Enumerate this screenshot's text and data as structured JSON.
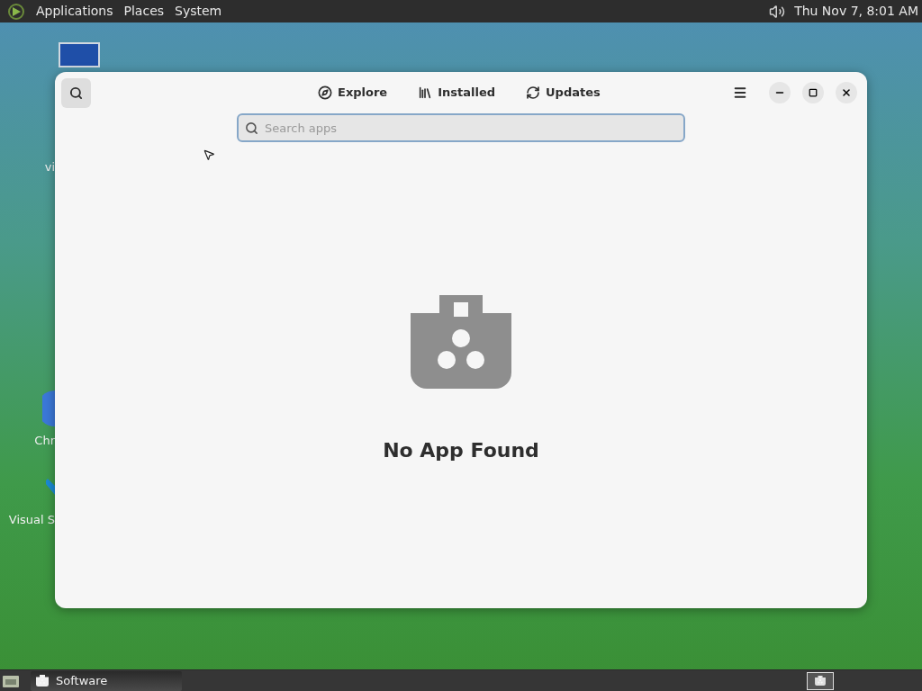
{
  "top_panel": {
    "menus": [
      "Applications",
      "Places",
      "System"
    ],
    "clock": "Thu Nov 7, 8:01 AM"
  },
  "desktop_icons": [
    {
      "kind": "monitor",
      "label": "vi"
    },
    {
      "kind": "browser",
      "label": "Chr"
    },
    {
      "kind": "editor",
      "label": "Visual S"
    }
  ],
  "window": {
    "search_toggle": {
      "active": true
    },
    "tabs": [
      {
        "kind": "explore",
        "label": "Explore",
        "selected": false
      },
      {
        "kind": "installed",
        "label": "Installed",
        "selected": false
      },
      {
        "kind": "updates",
        "label": "Updates",
        "selected": false
      }
    ],
    "search": {
      "placeholder": "Search apps",
      "focused": true
    },
    "empty_state": {
      "message": "No App Found"
    }
  },
  "taskbar": {
    "tasks": [
      {
        "label": "Software",
        "selected": false
      }
    ]
  }
}
